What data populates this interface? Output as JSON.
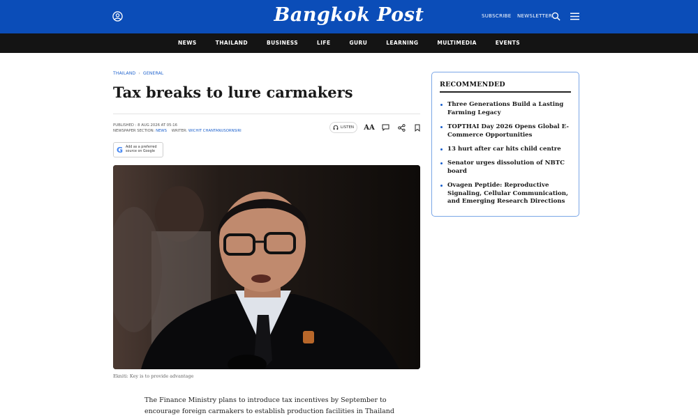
{
  "header": {
    "logo": "Bangkok Post",
    "subscribe_label": "SUBSCRIBE",
    "newsletter_label": "NEWSLETTER"
  },
  "nav": {
    "items": [
      "NEWS",
      "THAILAND",
      "BUSINESS",
      "LIFE",
      "GURU",
      "LEARNING",
      "MULTIMEDIA",
      "EVENTS"
    ]
  },
  "article": {
    "breadcrumb": [
      "THAILAND",
      "GENERAL"
    ],
    "title": "Tax breaks to lure carmakers",
    "published": "PUBLISHED : 8 AUG 2026 AT 05:16",
    "section_label": "NEWSPAPER SECTION:",
    "section_value": "NEWS",
    "writer_label": "WRITER:",
    "writer_value": "WICHIT CHANTANUSORNSIRI",
    "listen_label": "LISTEN",
    "font_size_label": "AA",
    "google_badge_line1": "Add as a preferred",
    "google_badge_line2": "source on Google",
    "caption": "Ekniti: Key is to provide advantage",
    "body_line1": "The Finance Ministry plans to introduce tax incentives by September to",
    "body_line2": "encourage foreign carmakers to establish production facilities in Thailand"
  },
  "recommended": {
    "title": "RECOMMENDED",
    "items": [
      "Three Generations Build a Lasting Farming Legacy",
      "TOPTHAI Day 2026 Opens Global E-Commerce Opportunities",
      "13 hurt after car hits child centre",
      "Senator urges dissolution of NBTC board",
      "Ovagen Peptide: Reproductive Signaling, Cellular Communication, and Emerging Research Directions"
    ]
  },
  "colors": {
    "header_blue": "#0b4db8",
    "nav_black": "#141414",
    "link_blue": "#1a5fcc",
    "card_border": "#7aa6e6"
  },
  "icons": {
    "user": "user-icon",
    "search": "search-icon",
    "menu": "menu-icon",
    "headphones": "headphones-icon",
    "comment": "comment-icon",
    "share": "share-icon",
    "bookmark": "bookmark-icon",
    "google": "google-icon"
  }
}
